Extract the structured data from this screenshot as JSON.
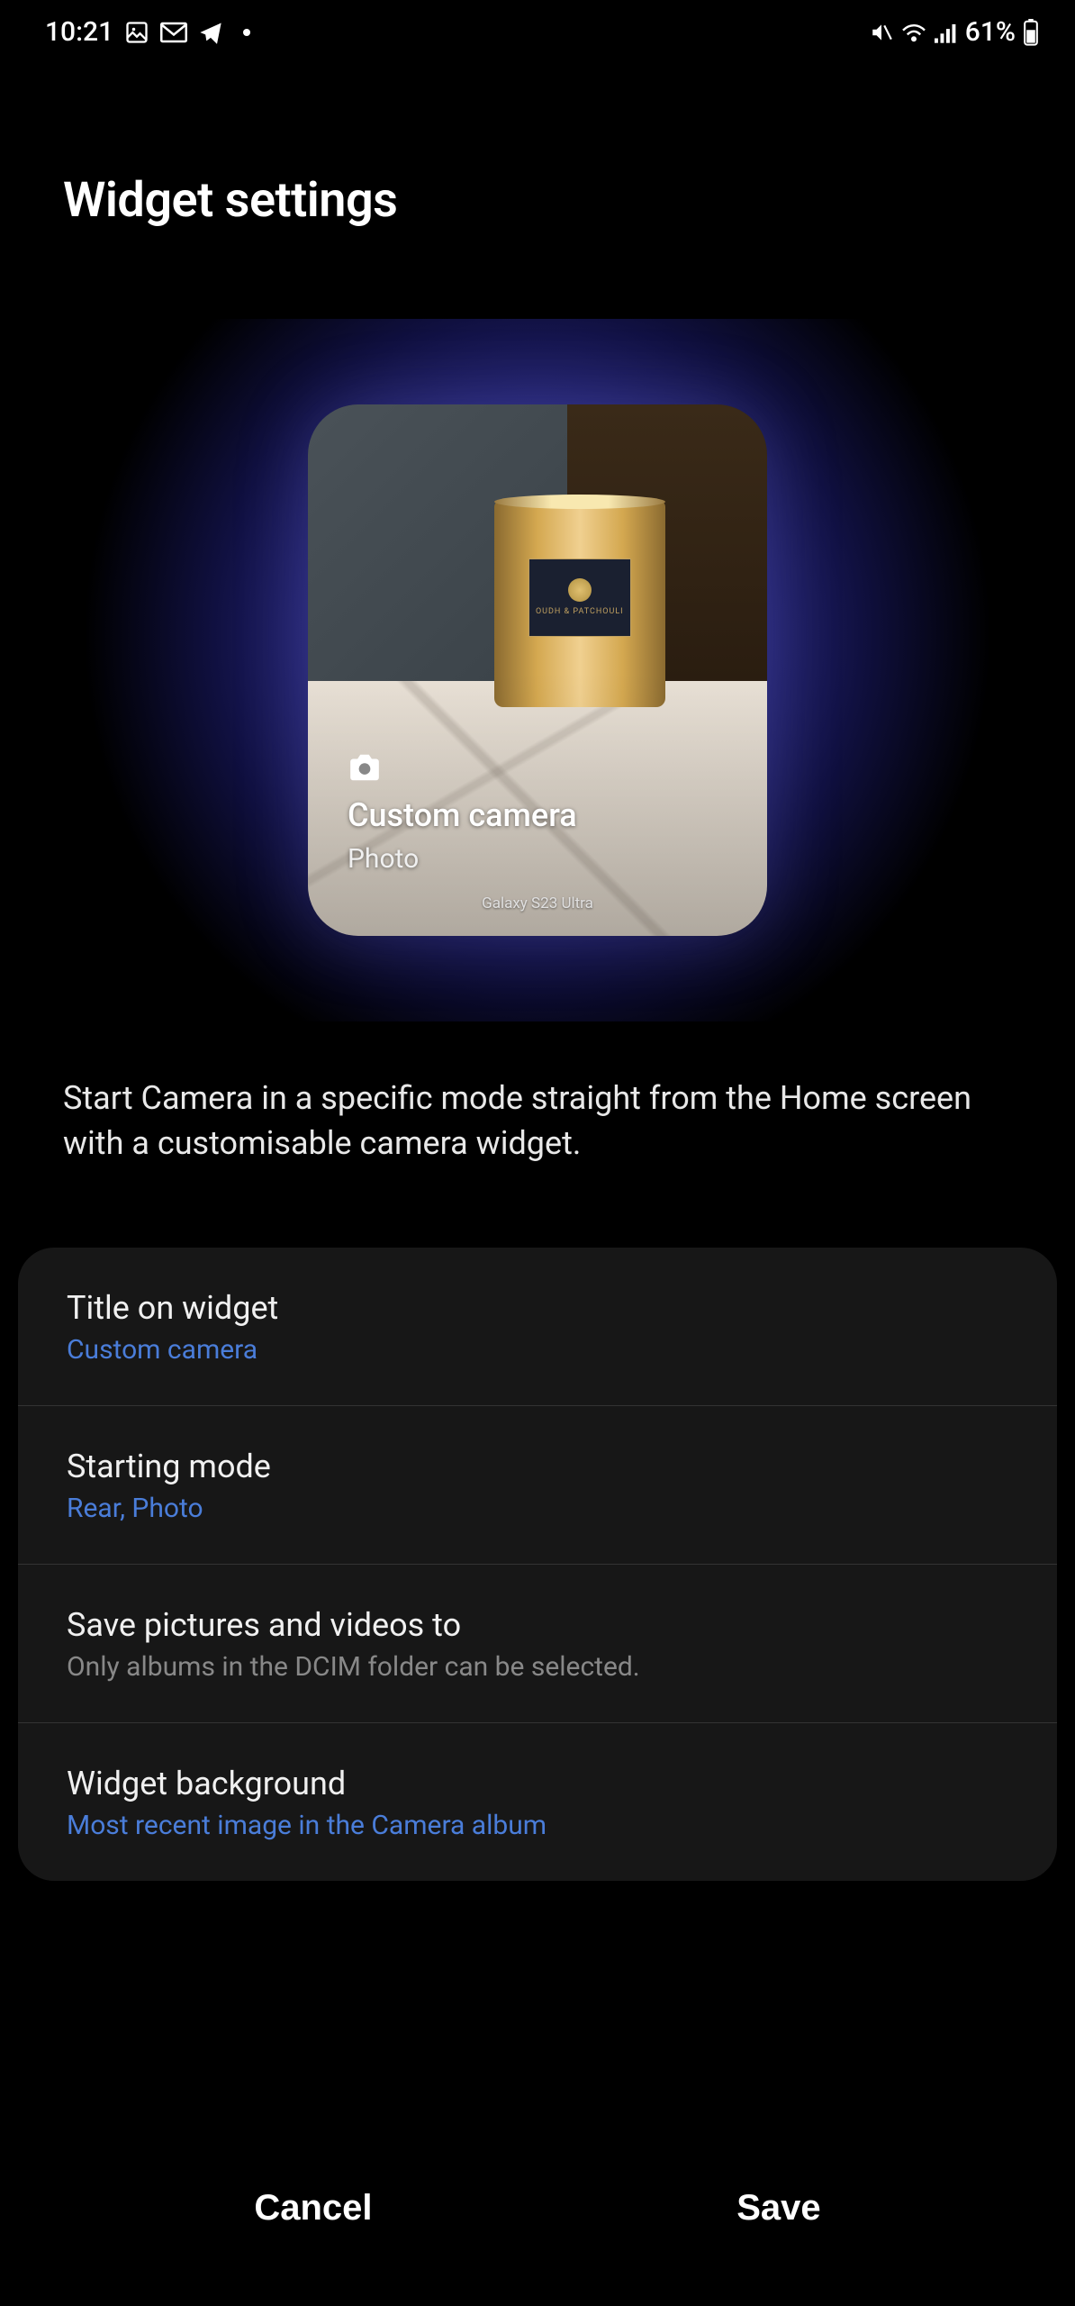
{
  "status": {
    "time": "10:21",
    "battery_text": "61%"
  },
  "header": {
    "title": "Widget settings"
  },
  "preview": {
    "widget_title": "Custom camera",
    "widget_subtitle": "Photo",
    "device_label": "Galaxy S23 Ultra"
  },
  "description": "Start Camera in a specific mode straight from the Home screen with a customisable camera widget.",
  "settings": {
    "title_on_widget": {
      "label": "Title on widget",
      "value": "Custom camera"
    },
    "starting_mode": {
      "label": "Starting mode",
      "value": "Rear, Photo"
    },
    "save_to": {
      "label": "Save pictures and videos to",
      "hint": "Only albums in the DCIM folder can be selected."
    },
    "background": {
      "label": "Widget background",
      "value": "Most recent image in the Camera album"
    }
  },
  "buttons": {
    "cancel": "Cancel",
    "save": "Save"
  }
}
